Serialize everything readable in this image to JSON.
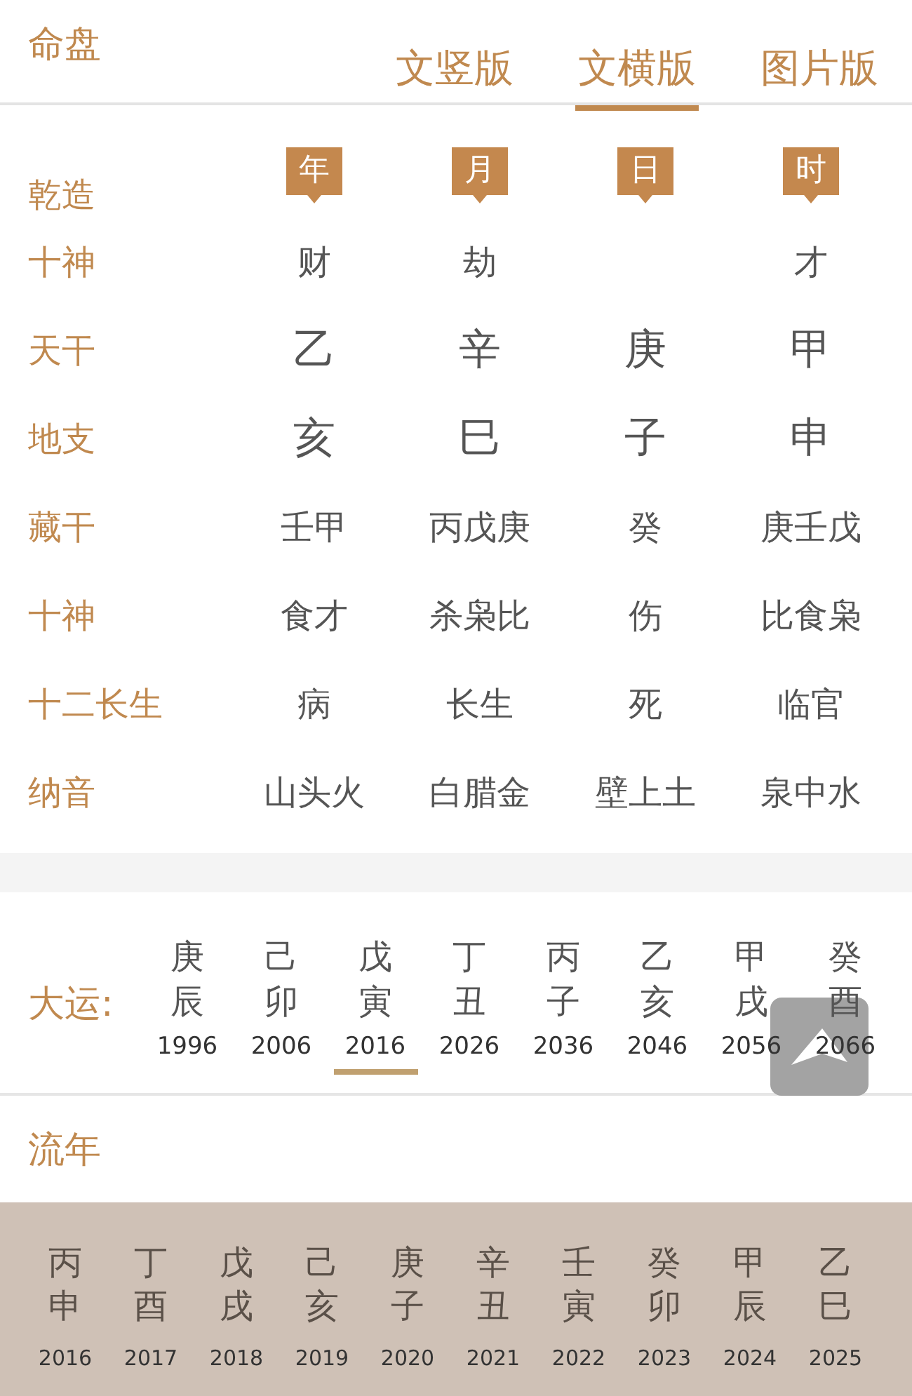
{
  "header": {
    "title": "命盘",
    "tabs": [
      {
        "label": "文竖版",
        "selected": false
      },
      {
        "label": "文横版",
        "selected": true
      },
      {
        "label": "图片版",
        "selected": false
      }
    ]
  },
  "pillars": {
    "label": "乾造",
    "columns": [
      "年",
      "月",
      "日",
      "时"
    ]
  },
  "rows": [
    {
      "label": "十神",
      "kind": "normal",
      "cells": [
        "财",
        "劫",
        null,
        "才"
      ]
    },
    {
      "label": "天干",
      "kind": "large",
      "cells": [
        "乙",
        "辛",
        "庚",
        "甲"
      ]
    },
    {
      "label": "地支",
      "kind": "large",
      "cells": [
        "亥",
        "巳",
        "子",
        "申"
      ]
    },
    {
      "label": "藏干",
      "kind": "normal",
      "cells": [
        "壬甲",
        "丙戊庚",
        "癸",
        "庚壬戊"
      ]
    },
    {
      "label": "十神",
      "kind": "normal",
      "cells": [
        "食才",
        "杀枭比",
        "伤",
        "比食枭"
      ]
    },
    {
      "label": "十二长生",
      "kind": "normal",
      "cells": [
        "病",
        "长生",
        "死",
        "临官"
      ]
    },
    {
      "label": "纳音",
      "kind": "normal",
      "cells": [
        "山头火",
        "白腊金",
        "壁上土",
        "泉中水"
      ]
    }
  ],
  "dayun": {
    "label": "大运:",
    "items": [
      {
        "stem": "庚",
        "branch": "辰",
        "year": "1996",
        "selected": false
      },
      {
        "stem": "己",
        "branch": "卯",
        "year": "2006",
        "selected": false
      },
      {
        "stem": "戊",
        "branch": "寅",
        "year": "2016",
        "selected": true
      },
      {
        "stem": "丁",
        "branch": "丑",
        "year": "2026",
        "selected": false
      },
      {
        "stem": "丙",
        "branch": "子",
        "year": "2036",
        "selected": false
      },
      {
        "stem": "乙",
        "branch": "亥",
        "year": "2046",
        "selected": false
      },
      {
        "stem": "甲",
        "branch": "戌",
        "year": "2056",
        "selected": false
      },
      {
        "stem": "癸",
        "branch": "酉",
        "year": "2066",
        "selected": false
      }
    ]
  },
  "liunian": {
    "title": "流年",
    "items": [
      {
        "stem": "丙",
        "branch": "申",
        "year": "2016"
      },
      {
        "stem": "丁",
        "branch": "酉",
        "year": "2017"
      },
      {
        "stem": "戊",
        "branch": "戌",
        "year": "2018"
      },
      {
        "stem": "己",
        "branch": "亥",
        "year": "2019"
      },
      {
        "stem": "庚",
        "branch": "子",
        "year": "2020"
      },
      {
        "stem": "辛",
        "branch": "丑",
        "year": "2021"
      },
      {
        "stem": "壬",
        "branch": "寅",
        "year": "2022"
      },
      {
        "stem": "癸",
        "branch": "卯",
        "year": "2023"
      },
      {
        "stem": "甲",
        "branch": "辰",
        "year": "2024"
      },
      {
        "stem": "乙",
        "branch": "巳",
        "year": "2025"
      }
    ]
  }
}
